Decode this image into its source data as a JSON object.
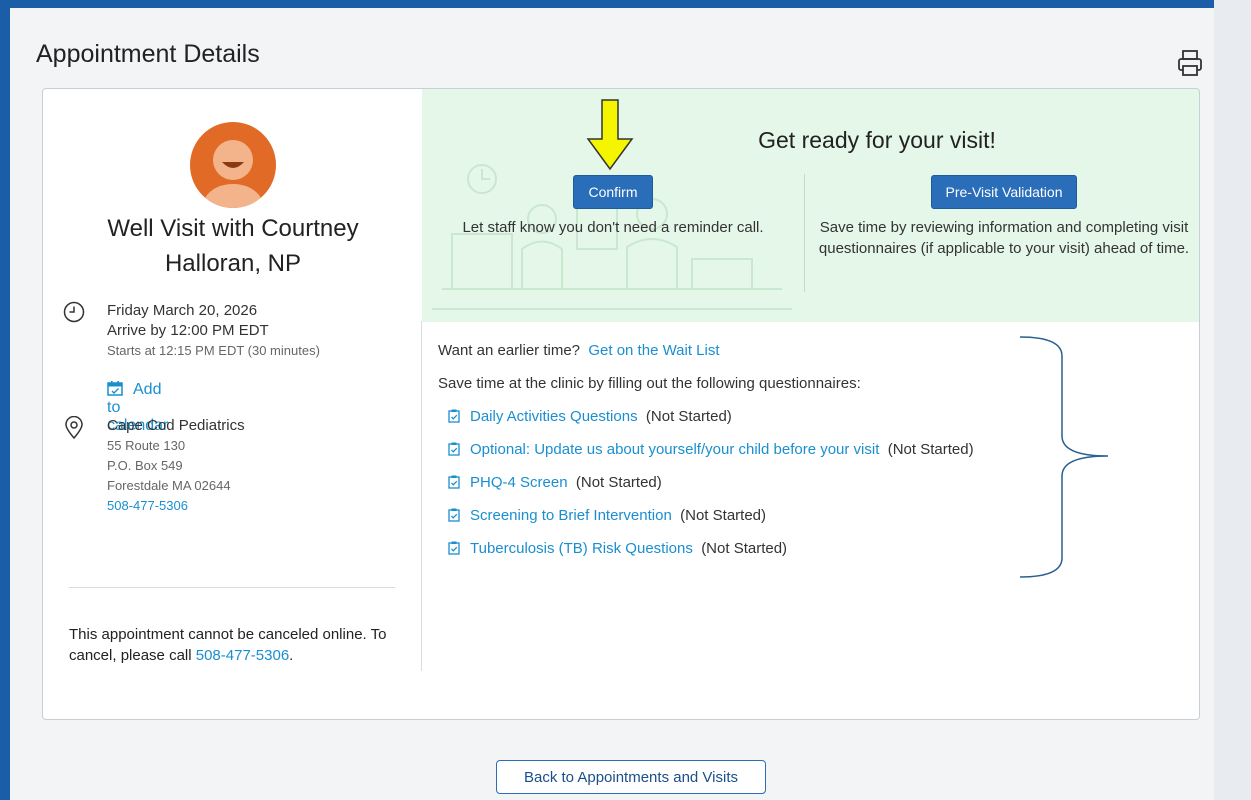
{
  "header": {
    "title": "Appointment Details",
    "print_icon": "printer-icon"
  },
  "visit": {
    "title": "Well Visit with Courtney Halloran, NP",
    "date": "Friday March 20, 2026",
    "arrive": "Arrive by 12:00 PM EDT",
    "starts": "Starts at 12:15 PM EDT (30 minutes)",
    "add_calendar": "Add to calendar"
  },
  "location": {
    "name": "Cape Cod Pediatrics",
    "address1": "55 Route 130",
    "address2": "P.O. Box 549",
    "city": "Forestdale MA 02644",
    "phone": "508-477-5306"
  },
  "cancel": {
    "text": "This appointment cannot be canceled online. To cancel, please call ",
    "phone": "508-477-5306",
    "end": "."
  },
  "banner": {
    "title": "Get ready for your visit!",
    "confirm_label": "Confirm",
    "confirm_desc": "Let staff know you don't need a reminder call.",
    "previsit_label": "Pre-Visit Validation",
    "previsit_desc": "Save time by reviewing information and completing visit questionnaires (if applicable to your visit) ahead of time."
  },
  "waitlist": {
    "prompt": "Want an earlier time?",
    "link": "Get on the Wait List"
  },
  "questionnaires": {
    "intro": "Save time at the clinic by filling out the following questionnaires:",
    "items": [
      {
        "label": "Daily Activities Questions",
        "status": "(Not Started)"
      },
      {
        "label": "Optional: Update us about yourself/your child before your visit",
        "status": "(Not Started)"
      },
      {
        "label": "PHQ-4 Screen",
        "status": "(Not Started)"
      },
      {
        "label": "Screening to Brief Intervention",
        "status": "(Not Started)"
      },
      {
        "label": "Tuberculosis (TB) Risk Questions",
        "status": "(Not Started)"
      }
    ]
  },
  "footer": {
    "back_label": "Back to Appointments and Visits"
  },
  "colors": {
    "accent": "#1a8fd0",
    "primary_button": "#2a6db8",
    "banner_bg": "#e5f7e8",
    "avatar": "#e06a26",
    "arrow": "#f5f500"
  }
}
